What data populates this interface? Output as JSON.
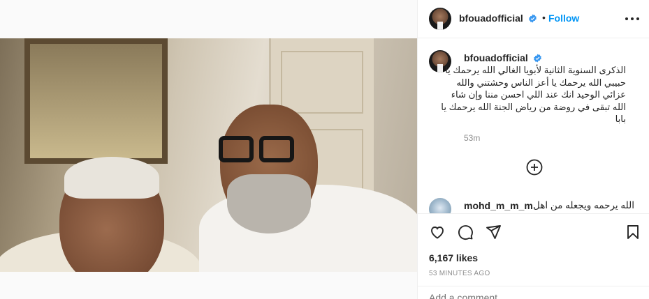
{
  "post": {
    "author": "bfouadofficial",
    "follow_label": "Follow",
    "separator": "•",
    "caption": "الذكرى السنوية الثانية لأبويا الغالي الله يرحمك يا حبيبي الله يرحمك يا أعز الناس وحشتني والله عزائي الوحيد انك عند اللي احسن مننا وإن شاء الله تبقى في روضة من رياض الجنة الله يرحمك يا بابا",
    "caption_time": "53m",
    "likes": "6,167 likes",
    "posted": "53 MINUTES AGO"
  },
  "comments": [
    {
      "user": "mohd_m_m_m",
      "text": "الله يرحمه ويجعله من اهل"
    }
  ],
  "add_comment": {
    "placeholder": "Add a comment..."
  },
  "icons": {
    "verified": "verified-badge-icon",
    "more": "more-options-icon",
    "load_more": "load-more-comments-icon",
    "like": "heart-icon",
    "comment": "comment-icon",
    "share": "share-icon",
    "save": "bookmark-icon"
  },
  "colors": {
    "link_blue": "#0095f6",
    "verified_blue": "#3897f0",
    "muted_text": "#8e8e8e",
    "border": "#efefef"
  }
}
